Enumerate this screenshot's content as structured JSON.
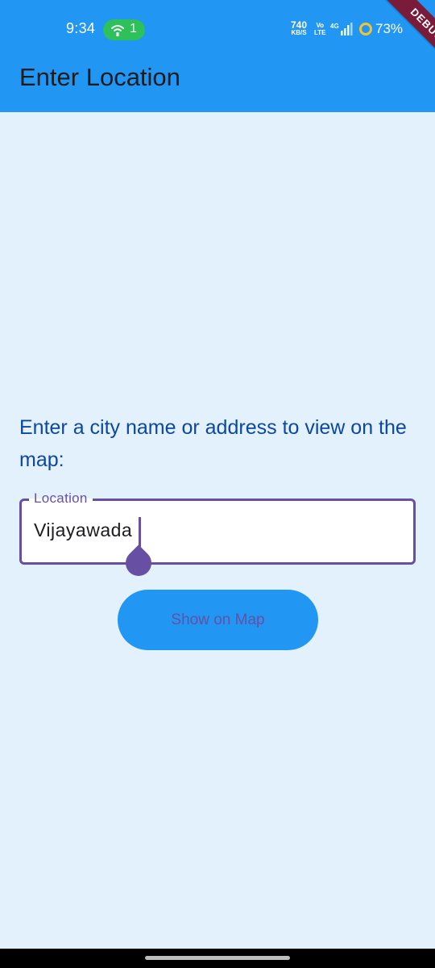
{
  "status_bar": {
    "time": "9:34",
    "hotspot_count": "1",
    "hotspot_icon": "hotspot-icon",
    "net_speed_value": "740",
    "net_speed_unit": "KB/S",
    "volte_top": "Vo",
    "volte_bottom": "LTE",
    "network_type": "4G",
    "battery_percent": "73%",
    "pill_color": "#2ec05a"
  },
  "debug_banner": "DEBUG",
  "app_bar": {
    "title": "Enter Location",
    "color": "#2196f3"
  },
  "main": {
    "prompt": "Enter a city name or address to view on the map:",
    "location_field": {
      "label": "Location",
      "value": "Vijayawada"
    },
    "show_button_label": "Show on Map"
  },
  "theme": {
    "background": "#e3f1fc",
    "accent": "#6750a4",
    "prompt_color": "#0d47a1"
  }
}
